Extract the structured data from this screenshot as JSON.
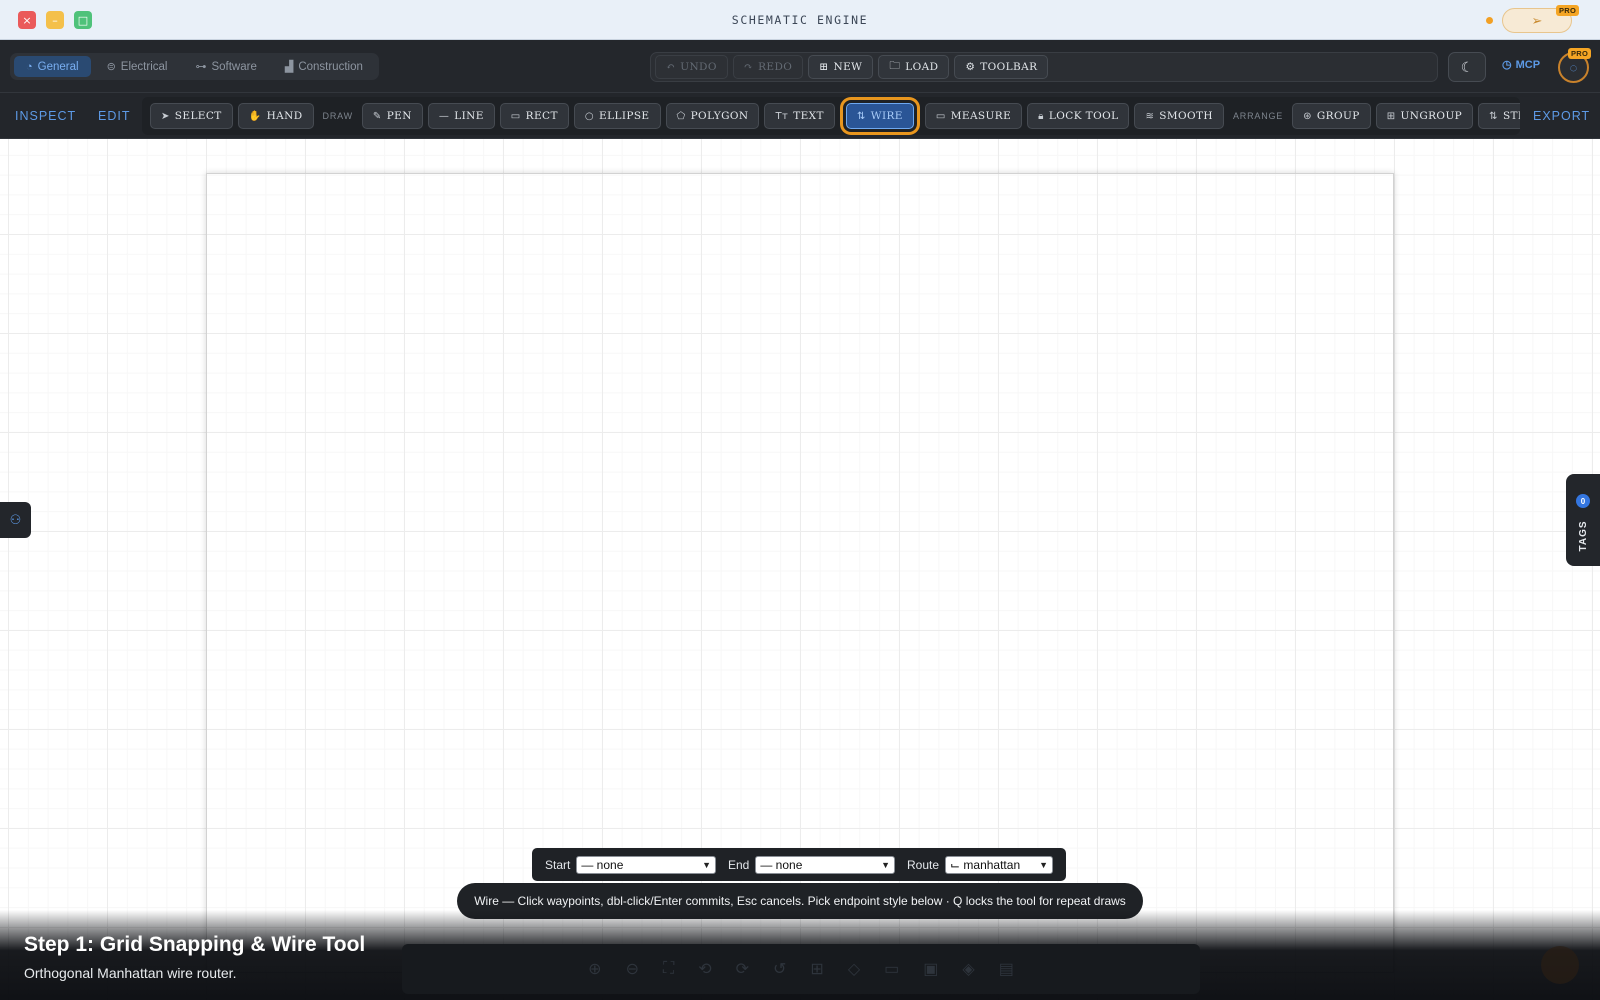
{
  "window": {
    "title": "SCHEMATIC ENGINE",
    "pro_badge": "PRO",
    "traffic_lights": {
      "close": "×",
      "minimize": "–",
      "maximize": "□"
    }
  },
  "categories": [
    {
      "label": "General",
      "icon": "general-icon",
      "active": true
    },
    {
      "label": "Electrical",
      "icon": "electrical-icon"
    },
    {
      "label": "Software",
      "icon": "software-icon"
    },
    {
      "label": "Construction",
      "icon": "construction-icon"
    }
  ],
  "history": {
    "undo": "UNDO",
    "redo": "REDO",
    "new": "NEW",
    "load": "LOAD",
    "toolbar": "TOOLBAR"
  },
  "header_right": {
    "mcp": "MCP",
    "pro_badge": "PRO"
  },
  "modes": {
    "inspect": "INSPECT",
    "edit": "EDIT",
    "export": "EXPORT"
  },
  "tools": {
    "select": "SELECT",
    "hand": "HAND",
    "draw_section": "DRAW",
    "pen": "PEN",
    "line": "LINE",
    "rect": "RECT",
    "ellipse": "ELLIPSE",
    "polygon": "POLYGON",
    "text": "TEXT",
    "text_icon": "Tт",
    "wire": "WIRE",
    "measure": "MEASURE",
    "lock_tool": "LOCK TOOL",
    "smooth": "SMOOTH",
    "arrange_section": "ARRANGE",
    "group": "GROUP",
    "ungroup": "UNGROUP",
    "straighten": "STRAIGHTEN",
    "active_tool": "WIRE"
  },
  "tags_panel": {
    "label": "TAGS",
    "count": "0"
  },
  "wire_options": {
    "start_label": "Start",
    "start_value": "— none",
    "end_label": "End",
    "end_value": "— none",
    "route_label": "Route",
    "route_value": "⌙ manhattan"
  },
  "hint": "Wire — Click waypoints, dbl-click/Enter commits, Esc cancels. Pick endpoint style below · Q locks the tool for repeat draws",
  "caption": {
    "title": "Step 1: Grid Snapping & Wire Tool",
    "subtitle": "Orthogonal Manhattan wire router."
  },
  "colors": {
    "accent": "#5d9ae6",
    "active_highlight": "#e8961e",
    "dark_bg": "#23262b"
  }
}
